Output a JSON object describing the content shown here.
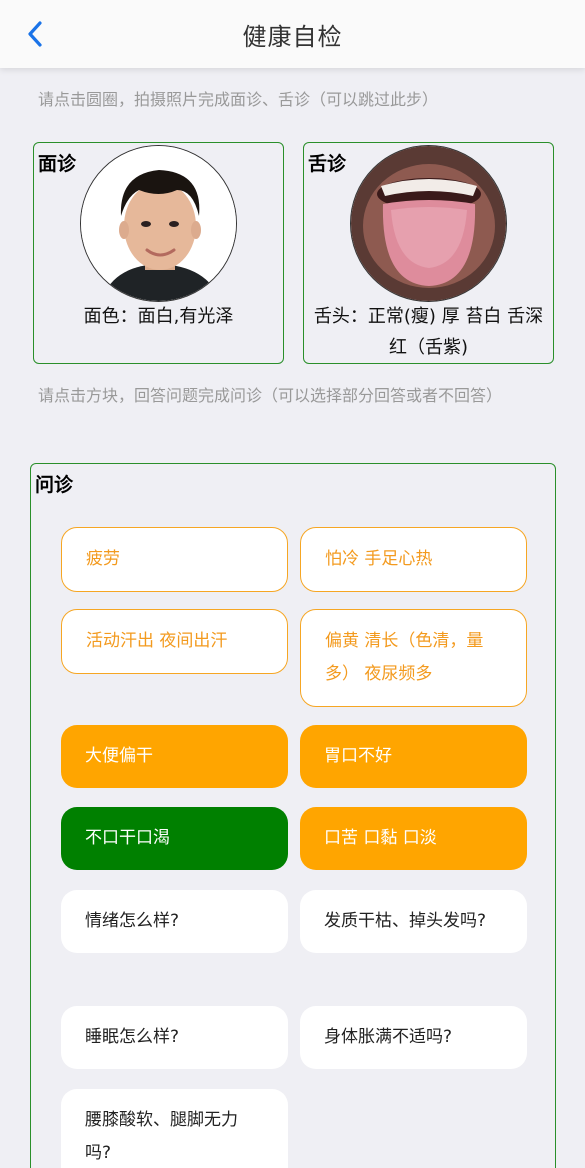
{
  "header": {
    "title": "健康自检",
    "back_icon": "chevron-left-icon"
  },
  "hints": {
    "photo": "请点击圆圈，拍摄照片完成面诊、舌诊（可以跳过此步）",
    "question": "请点击方块，回答问题完成问诊（可以选择部分回答或者不回答）"
  },
  "face": {
    "label": "面诊",
    "result": "面色：面白,有光泽"
  },
  "tongue": {
    "label": "舌诊",
    "result": "舌头：正常(瘦) 厚 苔白 舌深红（舌紫)"
  },
  "inquiry": {
    "label": "问诊",
    "items": [
      {
        "text": "疲劳",
        "state": "outline"
      },
      {
        "text": "怕冷 手足心热",
        "state": "outline"
      },
      {
        "text": "活动汗出 夜间出汗",
        "state": "outline"
      },
      {
        "text": "偏黄 清长（色清，量多） 夜尿频多",
        "state": "outline"
      },
      {
        "text": "大便偏干",
        "state": "orange"
      },
      {
        "text": "胃口不好",
        "state": "orange"
      },
      {
        "text": "不口干口渴",
        "state": "green"
      },
      {
        "text": "口苦 口黏 口淡",
        "state": "orange"
      },
      {
        "text": "情绪怎么样?",
        "state": "white"
      },
      {
        "text": "发质干枯、掉头发吗?",
        "state": "white"
      },
      {
        "text": "睡眠怎么样?",
        "state": "white"
      },
      {
        "text": "身体胀满不适吗?",
        "state": "white"
      },
      {
        "text": "腰膝酸软、腿脚无力吗?",
        "state": "white"
      }
    ]
  },
  "colors": {
    "accent": "#1a73e8",
    "orange": "#ffa500",
    "green": "#008000",
    "border": "#2a8f2a"
  }
}
